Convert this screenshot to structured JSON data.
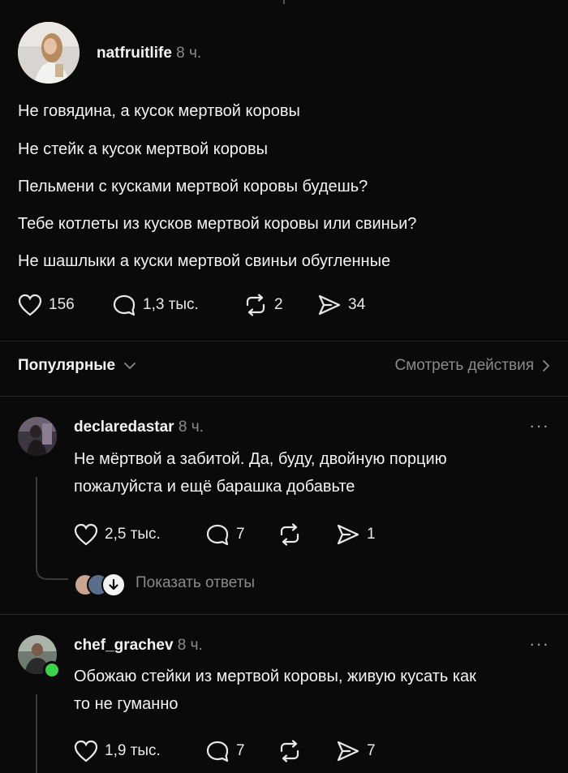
{
  "post": {
    "username": "natfruitlife",
    "time": "8 ч.",
    "lines": [
      "Не говядина, а кусок мертвой коровы",
      "Не стейк а кусок мертвой коровы",
      "Пельмени с кусками мертвой коровы будешь?",
      "Тебе котлеты из кусков мертвой коровы или свиньи?",
      "Не шашлыки а куски мертвой свиньи обугленные"
    ],
    "likes": "156",
    "replies": "1,3 тыс.",
    "reposts": "2",
    "shares": "34"
  },
  "filter": {
    "sort_label": "Популярные",
    "activity_link": "Смотреть действия"
  },
  "comments": [
    {
      "username": "declaredastar",
      "time": "8 ч.",
      "text_line1": "Не мёртвой а забитой. Да, буду, двойную порцию",
      "text_line2": "пожалуйста и ещё  барашка добавьте",
      "likes": "2,5 тыс.",
      "replies": "7",
      "reposts": "",
      "shares": "1",
      "show_replies": "Показать ответы"
    },
    {
      "username": "chef_grachev",
      "time": "8 ч.",
      "text_line1": "Обожаю стейки из мертвой коровы, живую кусать как",
      "text_line2": "то не гуманно",
      "likes": "1,9 тыс.",
      "replies": "7",
      "reposts": "",
      "shares": "7"
    }
  ],
  "icons": {
    "like": "heart-icon",
    "reply": "comment-bubble-icon",
    "repost": "repost-icon",
    "share": "send-icon",
    "more": "more-dots-icon",
    "chevron": "chevron-down-icon",
    "chevron_right": "chevron-right-icon",
    "online": "online-status-dot"
  },
  "colors": {
    "background": "#0a0a0a",
    "text": "#f3f3f3",
    "muted": "#8a8a8a",
    "online": "#3ad34a"
  }
}
